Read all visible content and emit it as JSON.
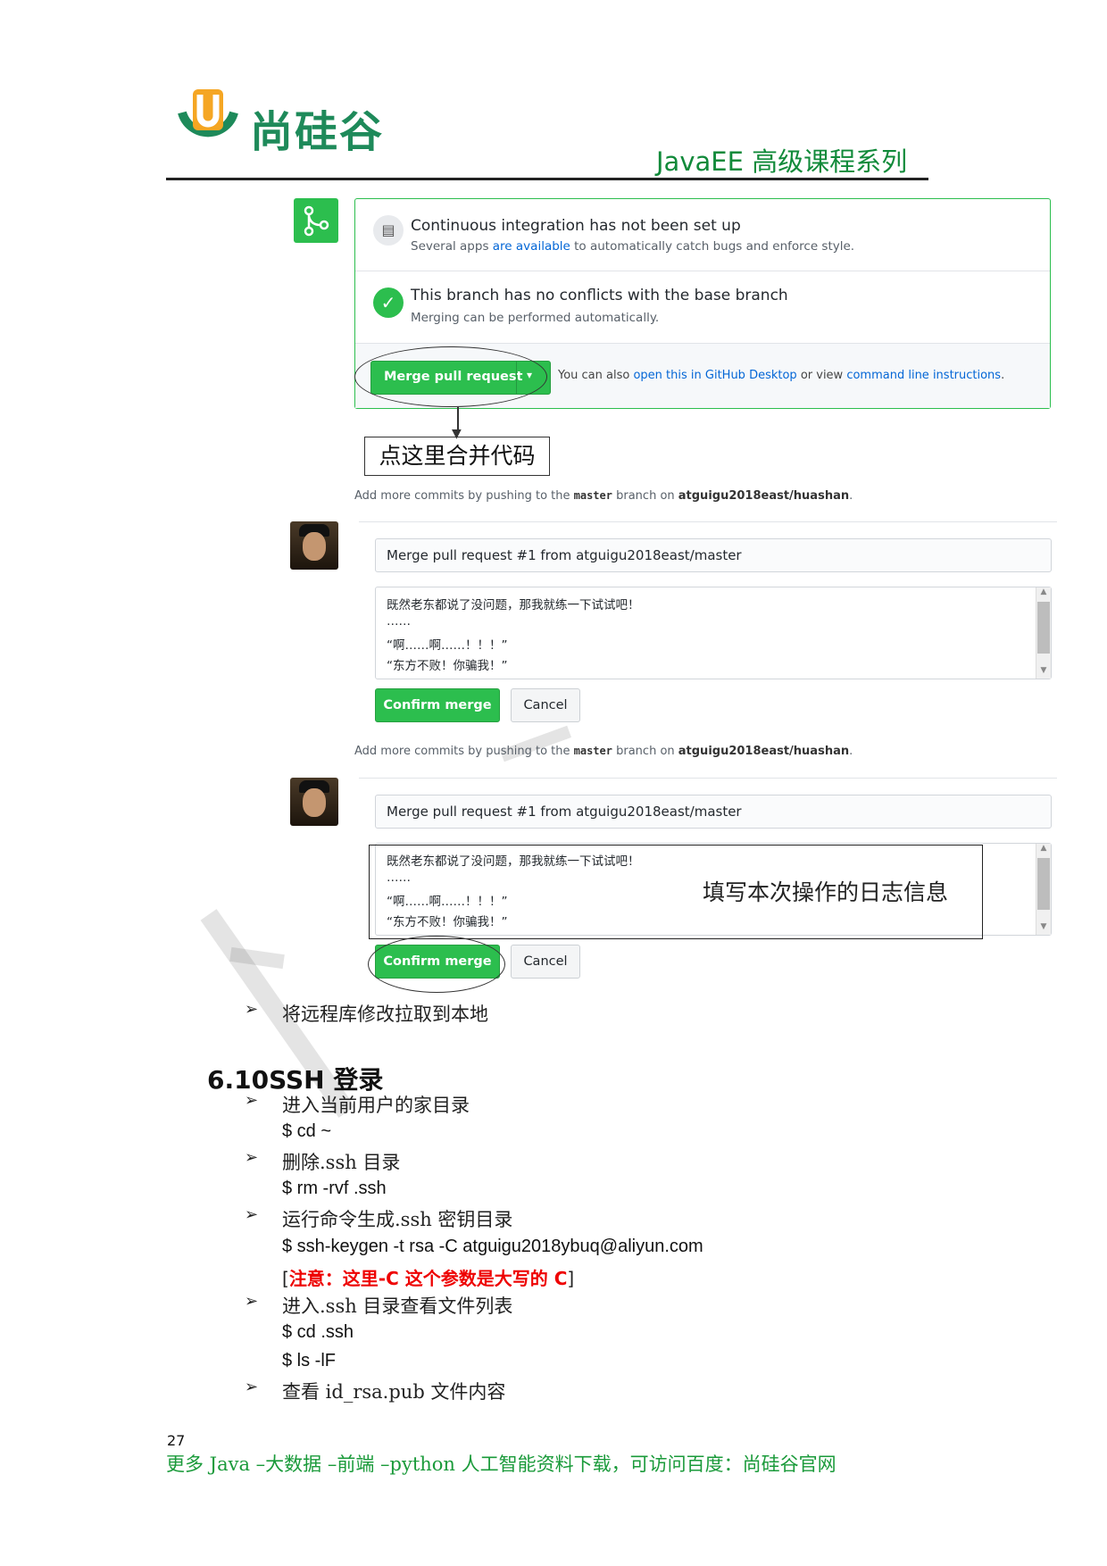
{
  "header": {
    "logo_text": "尚硅谷",
    "series_title": "JavaEE 高级课程系列"
  },
  "merge_box": {
    "ci_title": "Continuous integration has not been set up",
    "ci_sub_pre": "Several apps ",
    "ci_sub_link": "are available",
    "ci_sub_post": " to automatically catch bugs and enforce style.",
    "branch_title": "This branch has no conflicts with the base branch",
    "branch_sub": "Merging can be performed automatically.",
    "merge_button": "Merge pull request",
    "also_pre": "You can also ",
    "also_link1": "open this in GitHub Desktop",
    "also_mid": " or view ",
    "also_link2": "command line instructions",
    "also_post": "."
  },
  "callout_merge": "点这里合并代码",
  "add_more": {
    "pre": "Add more commits by pushing to the ",
    "branch": "master",
    "mid": " branch on ",
    "repo": "atguigu2018east/huashan",
    "post": "."
  },
  "commit_form": {
    "title_value": "Merge pull request #1 from atguigu2018east/master",
    "message_lines": [
      "既然老东都说了没问题，那我就练一下试试吧！",
      "……",
      "“啊……啊……！！！”",
      "“东方不败！你骗我！”"
    ],
    "confirm_button": "Confirm merge",
    "cancel_button": "Cancel"
  },
  "callout_log": "填写本次操作的日志信息",
  "bullets": {
    "pull_remote": "将远程库修改拉取到本地",
    "go_home": "进入当前用户的家目录",
    "delete_ssh": "删除.ssh 目录",
    "gen_ssh": "运行命令生成.ssh 密钥目录",
    "enter_ssh": "进入.ssh 目录查看文件列表",
    "view_pub": "查看 id_rsa.pub 文件内容"
  },
  "section_heading": "6.10SSH 登录",
  "commands": {
    "cd_home": "$ cd ~",
    "rm_ssh": "$ rm -rvf .ssh",
    "keygen": "$ ssh-keygen -t rsa -C atguigu2018ybuq@aliyun.com",
    "cd_ssh": "$ cd .ssh",
    "ls": "$ ls -lF"
  },
  "note": {
    "open": "[",
    "text": "注意：这里-C 这个参数是大写的 C",
    "close": "]"
  },
  "page_number": "27",
  "footer": "更多 Java –大数据 –前端 –python 人工智能资料下载，可访问百度：尚硅谷官网",
  "bullet_glyph": "➢"
}
